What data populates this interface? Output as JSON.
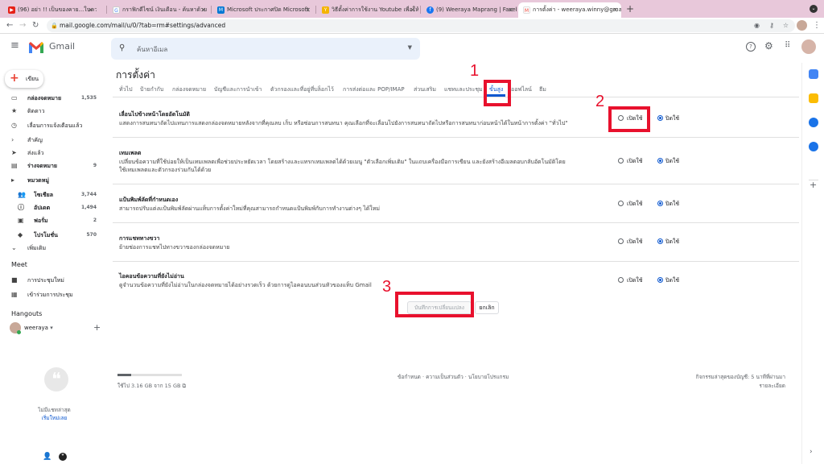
{
  "browser": {
    "tabs": [
      {
        "title": "(96) อย่า !! เป็นของคาย...ในความ",
        "color": "#e62117",
        "glyph": "▶"
      },
      {
        "title": "กราฟิกดีไซน์ เงินเดือน - ค้นหาด้วย",
        "color": "#4285f4",
        "glyph": "G"
      },
      {
        "title": "Microsoft ประกาศปิด Microsoft",
        "color": "#0078d4",
        "glyph": "M"
      },
      {
        "title": "วิธีตั้งค่าการใช้งาน Youtube เพื่อให้",
        "color": "#f4b400",
        "glyph": "Y"
      },
      {
        "title": "(9) Weeraya Maprang | Facebo",
        "color": "#1877f2",
        "glyph": "f"
      },
      {
        "title": "การตั้งค่า - weeraya.winny@gma",
        "color": "#ea4335",
        "glyph": "M"
      }
    ],
    "new_tab": "+",
    "url": "mail.google.com/mail/u/0/?tab=rm#settings/advanced"
  },
  "gmail": {
    "app_name": "Gmail",
    "search_placeholder": "ค้นหาอีเมล"
  },
  "sidebar": {
    "compose": "เขียน",
    "items": [
      {
        "label": "กล่องจดหมาย",
        "count": "1,535",
        "icon": "inbox-icon",
        "bold": true
      },
      {
        "label": "ติดดาว",
        "count": "",
        "icon": "star-icon"
      },
      {
        "label": "เลื่อนการแจ้งเตือนแล้ว",
        "count": "",
        "icon": "clock-icon"
      },
      {
        "label": "สำคัญ",
        "count": "",
        "icon": "important-icon"
      },
      {
        "label": "ส่งแล้ว",
        "count": "",
        "icon": "send-icon"
      },
      {
        "label": "ร่างจดหมาย",
        "count": "9",
        "icon": "draft-icon",
        "bold": true
      },
      {
        "label": "หมวดหมู่",
        "count": "",
        "icon": "label-icon",
        "bold": true
      }
    ],
    "sub_items": [
      {
        "label": "โซเชียล",
        "count": "3,744",
        "icon": "people-icon"
      },
      {
        "label": "อัปเดต",
        "count": "1,494",
        "icon": "info-icon"
      },
      {
        "label": "ฟอรั่ม",
        "count": "2",
        "icon": "forum-icon"
      },
      {
        "label": "โปรโมชั่น",
        "count": "570",
        "icon": "tag-icon"
      }
    ],
    "more": "เพิ่มเติม",
    "meet_heading": "Meet",
    "meet_items": [
      "การประชุมใหม่",
      "เข้าร่วมการประชุม"
    ],
    "hangouts_heading": "Hangouts",
    "hangouts_user": "weeraya",
    "no_chats": "ไม่มีแชทล่าสุด",
    "start_new": "เริ่มใหม่เลย"
  },
  "settings": {
    "title": "การตั้งค่า",
    "tabs": [
      "ทั่วไป",
      "ป้ายกำกับ",
      "กล่องจดหมาย",
      "บัญชีและการนำเข้า",
      "ตัวกรองและที่อยู่ที่บล็อกไว้",
      "การส่งต่อและ POP/IMAP",
      "ส่วนเสริม",
      "แชทและประชุม",
      "ขั้นสูง",
      "ออฟไลน์",
      "ธีม"
    ],
    "active_tab": "ขั้นสูง",
    "enable_label": "เปิดใช้",
    "disable_label": "ปิดใช้",
    "rows": [
      {
        "title": "เลื่อนไปข้างหน้าโดยอัตโนมัติ",
        "desc": "แสดงการสนทนาถัดไปแทนการแสดงกล่องจดหมายหลังจากที่คุณลบ เก็บ หรือซ่อนการสนทนา คุณเลือกที่จะเลื่อนไปยังการสนทนาถัดไปหรือการสนทนาก่อนหน้าได้ในหน้าการตั้งค่า \"ทั่วไป\"",
        "selected": "disable"
      },
      {
        "title": "เทมเพลต",
        "desc": "เปลี่ยนข้อความที่ใช้บ่อยให้เป็นเทมเพลตเพื่อช่วยประหยัดเวลา โดยสร้างและแทรกเทมเพลตได้ด้วยเมนู \"ตัวเลือกเพิ่มเติม\" ในแถบเครื่องมือการเขียน และยังสร้างอีเมลตอบกลับอัตโนมัติโดยใช้เทมเพลตและตัวกรองร่วมกันได้ด้วย",
        "selected": "disable"
      },
      {
        "title": "แป้นพิมพ์ลัดที่กำหนดเอง",
        "desc": "สามารถปรับแต่งแป้นพิมพ์ลัดผ่านแท็บการตั้งค่าใหม่ที่คุณสามารถกำหนดแป้นพิมพ์กับการทำงานต่างๆ ได้ใหม่",
        "selected": "disable"
      },
      {
        "title": "การแชททางขวา",
        "desc": "ย้ายช่องการแชทไปทางขวาของกล่องจดหมาย",
        "selected": "disable"
      },
      {
        "title": "ไอคอนข้อความที่ยังไม่อ่าน",
        "desc": "ดูจำนวนข้อความที่ยังไม่อ่านในกล่องจดหมายได้อย่างรวดเร็ว ด้วยการดูไอคอนบนส่วนหัวของแท็บ Gmail",
        "selected": "disable"
      }
    ],
    "save_button": "บันทึกการเปลี่ยนแปลง",
    "cancel_button": "ยกเลิก"
  },
  "footer": {
    "storage": "ใช้ไป 3.16 GB จาก 15 GB",
    "storage_fraction": 0.21,
    "links": "ข้อกำหนด · ความเป็นส่วนตัว · นโยบายโปรแกรม",
    "activity": "กิจกรรมล่าสุดของบัญชี: 5 นาทีที่ผ่านมา",
    "details": "รายละเอียด"
  },
  "annotations": [
    "1",
    "2",
    "3"
  ],
  "colors": {
    "accent": "#0b57d0",
    "annotation": "#e8112d",
    "tabbar": "#e8c8da"
  }
}
